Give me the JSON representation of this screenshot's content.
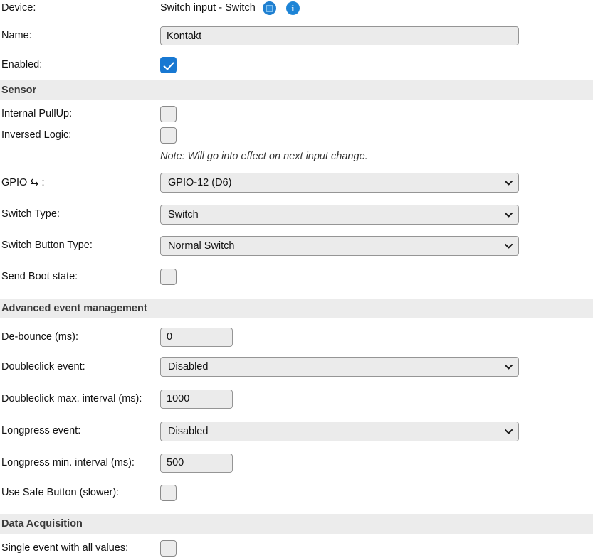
{
  "device": {
    "label": "Device:",
    "value": "Switch input - Switch",
    "page_icon_name": "device-page-icon",
    "info_icon_name": "info-icon",
    "info_glyph": "i"
  },
  "name_field": {
    "label": "Name:",
    "value": "Kontakt",
    "placeholder": ""
  },
  "enabled": {
    "label": "Enabled:",
    "checked": true
  },
  "sections": {
    "sensor": "Sensor",
    "advanced": "Advanced event management",
    "data_acquisition": "Data Acquisition"
  },
  "sensor": {
    "internal_pullup": {
      "label": "Internal PullUp:",
      "checked": false
    },
    "inversed_logic": {
      "label": "Inversed Logic:",
      "checked": false
    },
    "note": "Note: Will go into effect on next input change.",
    "gpio": {
      "label": "GPIO ⇆ :",
      "value": "GPIO-12 (D6)",
      "options": [
        "GPIO-12 (D6)"
      ]
    },
    "switch_type": {
      "label": "Switch Type:",
      "value": "Switch",
      "options": [
        "Switch"
      ]
    },
    "switch_button_type": {
      "label": "Switch Button Type:",
      "value": "Normal Switch",
      "options": [
        "Normal Switch"
      ]
    },
    "send_boot_state": {
      "label": "Send Boot state:",
      "checked": false
    }
  },
  "advanced": {
    "debounce": {
      "label": "De-bounce (ms):",
      "value": "0"
    },
    "doubleclick_event": {
      "label": "Doubleclick event:",
      "value": "Disabled",
      "options": [
        "Disabled"
      ]
    },
    "doubleclick_interval": {
      "label": "Doubleclick max. interval (ms):",
      "value": "1000"
    },
    "longpress_event": {
      "label": "Longpress event:",
      "value": "Disabled",
      "options": [
        "Disabled"
      ]
    },
    "longpress_interval": {
      "label": "Longpress min. interval (ms):",
      "value": "500"
    },
    "safe_button": {
      "label": "Use Safe Button (slower):",
      "checked": false
    }
  },
  "data_acquisition": {
    "single_event": {
      "label": "Single event with all values:",
      "checked": false
    }
  },
  "colors": {
    "accent": "#1878d2",
    "section_bg": "#ececec",
    "field_bg": "#ebebeb",
    "field_border": "#959595"
  }
}
